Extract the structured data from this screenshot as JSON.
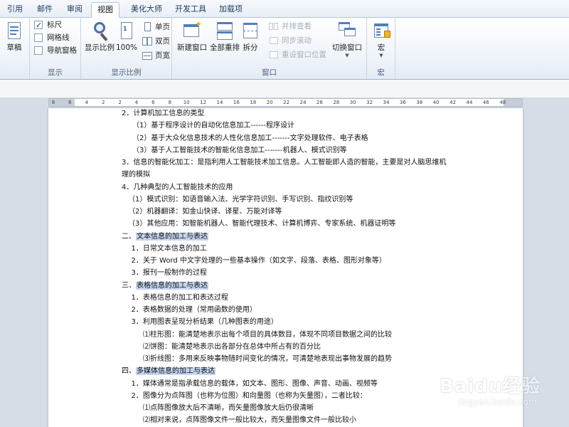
{
  "tabs": [
    {
      "label": "引用"
    },
    {
      "label": "邮件"
    },
    {
      "label": "审阅"
    },
    {
      "label": "视图",
      "active": true
    },
    {
      "label": "美化大师"
    },
    {
      "label": "开发工具"
    },
    {
      "label": "加载项"
    }
  ],
  "ribbon": {
    "draft": {
      "label": "草稿"
    },
    "show": {
      "label": "显示",
      "ruler": {
        "label": "标尺",
        "checked": true
      },
      "gridlines": {
        "label": "网格线",
        "checked": false
      },
      "nav_pane": {
        "label": "导航窗格",
        "checked": false
      }
    },
    "zoom": {
      "label": "显示比例",
      "zoom_btn": "显示比例",
      "percent_btn": "100%",
      "one_page": "单页",
      "two_pages": "双页",
      "page_width": "页宽"
    },
    "window": {
      "label": "窗口",
      "new_window": "新建窗口",
      "arrange_all": "全部重排",
      "split": "拆分",
      "side_by_side": "并排查看",
      "sync_scroll": "同步滚动",
      "reset_position": "重设窗口位置",
      "switch_windows": "切换窗口"
    },
    "macros": {
      "label": "宏",
      "macros_btn": "宏"
    }
  },
  "ruler": {
    "ticks": [
      "8",
      "6",
      "4",
      "2",
      "2",
      "4",
      "6",
      "8",
      "10",
      "12",
      "14",
      "16",
      "18",
      "20",
      "22",
      "24",
      "26",
      "28",
      "30",
      "32",
      "34",
      "36",
      "38",
      "40",
      "42",
      "44",
      "46",
      "48"
    ]
  },
  "document": {
    "lines": [
      {
        "text": "2．计算机加工信息的类型",
        "indent": 0
      },
      {
        "text": "（1）基于程序设计的自动化信息加工------程序设计",
        "indent": 1
      },
      {
        "text": "（2）基于大众化信息技术的人性化信息加工-------文字处理软件、电子表格",
        "indent": 1
      },
      {
        "text": "（3）基于人工智能技术的智能化信息加工-------机器人、模式识别等",
        "indent": 1
      },
      {
        "text": "3．信息的智能化加工：是指利用人工智能技术加工信息。人工智能即人造的智能，主要是对人脑思维机",
        "indent": 0
      },
      {
        "text": "理的模拟",
        "indent": 0
      },
      {
        "text": "4．几种典型的人工智能技术的应用",
        "indent": 0
      },
      {
        "text": "（1）模式识别：如语音输入法、光学字符识别、手写识别、指纹识别等",
        "indent": 0.6
      },
      {
        "text": "（2）机器翻译：如金山快译、译星、万能对译等",
        "indent": 0.6
      },
      {
        "text": "（3）其他应用：如智能机器人、智能代理技术、计算机博弈、专家系统、机器证明等",
        "indent": 0.6
      },
      {
        "prefix": "二、",
        "text": "文本信息的加工与表达",
        "indent": 0,
        "highlight": true
      },
      {
        "text": "1．日常文本信息的加工",
        "indent": 0.9
      },
      {
        "text": "2．关于 Word 中文字处理的一些基本操作（如文字、段落、表格、图形对象等）",
        "indent": 0.9
      },
      {
        "text": "3．报刊一般制作的过程",
        "indent": 0.9
      },
      {
        "prefix": "三、",
        "text": "表格信息的加工与表达",
        "indent": 0,
        "highlight": true
      },
      {
        "text": "1．表格信息的加工和表达过程",
        "indent": 0.9
      },
      {
        "text": "2．表格数据的处理（常用函数的使用）",
        "indent": 0.9
      },
      {
        "text": "3．利用图表呈现分析结果（几种图表的用途）",
        "indent": 0.9
      },
      {
        "text": "⑴柱形图：能清楚地表示出每个项目的具体数目，体现不同项目数据之间的比较",
        "indent": 2
      },
      {
        "text": "⑵饼图：能清楚地表示出各部分在总体中所占有的百分比",
        "indent": 2
      },
      {
        "text": "⑶折线图：多用来反映事物随时间变化的情况，可清楚地表现出事物发展的趋势",
        "indent": 2
      },
      {
        "prefix": "四、",
        "text": "多媒体信息的加工与表达",
        "indent": 0,
        "highlight": true
      },
      {
        "text": "1．媒体通常是指承载信息的载体，如文本、图形、图像、声音、动画、视频等",
        "indent": 0.9
      },
      {
        "text": "2．图像分为点阵图（也称为位图）和向量图（也称为矢量图），二者比较：",
        "indent": 0.9
      },
      {
        "text": "⑴点阵图像放大后不清晰，而矢量图像放大后仍很清晰",
        "indent": 2
      },
      {
        "text": "⑵相对来说，点阵图像文件一般比较大，而矢量图像文件一般比较小",
        "indent": 2
      }
    ]
  },
  "watermark": {
    "main": "Baidu经验",
    "sub": "jingyan.baidu.com"
  }
}
